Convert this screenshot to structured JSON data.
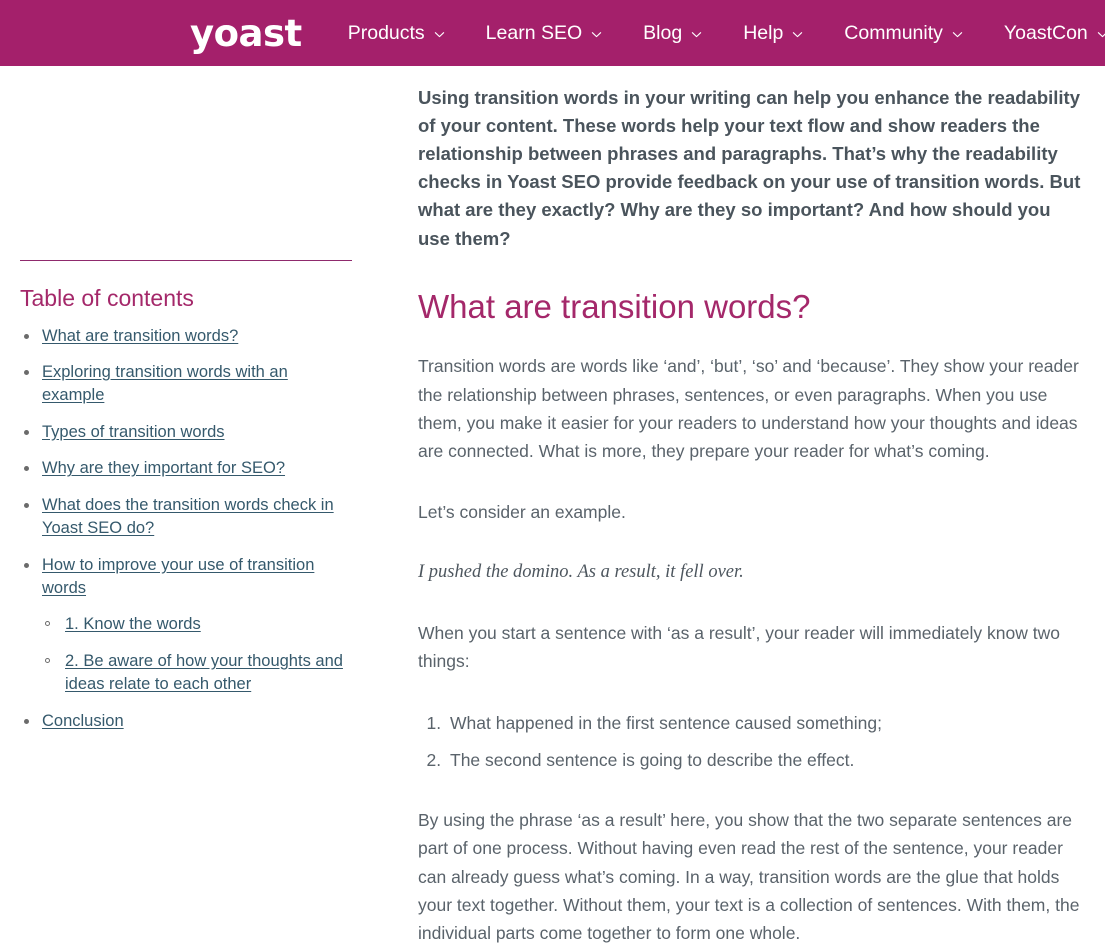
{
  "colors": {
    "brand_magenta": "#a4206b",
    "heading_magenta": "#a4286a",
    "link_slate": "#35596c",
    "body_gray": "#5a636b",
    "rule_purple": "#8f2a6d",
    "page_background": "#ffffff"
  },
  "header": {
    "logo_text": "yoast",
    "nav_items": [
      {
        "label": "Products",
        "icon": "chevron-down-icon"
      },
      {
        "label": "Learn SEO",
        "icon": "chevron-down-icon"
      },
      {
        "label": "Blog",
        "icon": "chevron-down-icon"
      },
      {
        "label": "Help",
        "icon": "chevron-down-icon"
      },
      {
        "label": "Community",
        "icon": "chevron-down-icon"
      },
      {
        "label": "YoastCon",
        "icon": "chevron-down-icon"
      }
    ]
  },
  "sidebar": {
    "toc_title": "Table of contents",
    "items": [
      {
        "label": "What are transition words?",
        "children": []
      },
      {
        "label": "Exploring transition words with an example",
        "children": []
      },
      {
        "label": "Types of transition words",
        "children": []
      },
      {
        "label": "Why are they important for SEO?",
        "children": []
      },
      {
        "label": "What does the transition words check in Yoast SEO do?",
        "children": []
      },
      {
        "label": "How to improve your use of transition words",
        "children": [
          {
            "label": "1. Know the words"
          },
          {
            "label": "2. Be aware of how your thoughts and ideas relate to each other"
          }
        ]
      },
      {
        "label": "Conclusion",
        "children": []
      }
    ]
  },
  "article": {
    "intro": "Using transition words in your writing can help you enhance the readability of your content. These words help your text flow and show readers the relationship between phrases and paragraphs. That’s why the readability checks in Yoast SEO provide feedback on your use of transition words. But what are they exactly? Why are they so important? And how should you use them?",
    "heading": "What are transition words?",
    "paragraph_1": "Transition words are words like ‘and’, ‘but’, ‘so’ and ‘because’. They show your reader the relationship between phrases, sentences, or even paragraphs. When you use them, you make it easier for your readers to understand how your thoughts and ideas are connected. What is more, they prepare your reader for what’s coming.",
    "paragraph_2": "Let’s consider an example.",
    "example_sentence": "I pushed the domino. As a result, it fell over.",
    "paragraph_3": "When you start a sentence with ‘as a result’, your reader will immediately know two things:",
    "ordered_items": [
      "What happened in the first sentence caused something;",
      "The second sentence is going to describe the effect."
    ],
    "paragraph_4": "By using the phrase ‘as a result’ here, you show that the two separate sentences are part of one process. Without having even read the rest of the sentence, your reader can already guess what’s coming. In a way, transition words are the glue that holds your text together. Without them, your text is a collection of sentences. With them, the individual parts come together to form one whole."
  }
}
